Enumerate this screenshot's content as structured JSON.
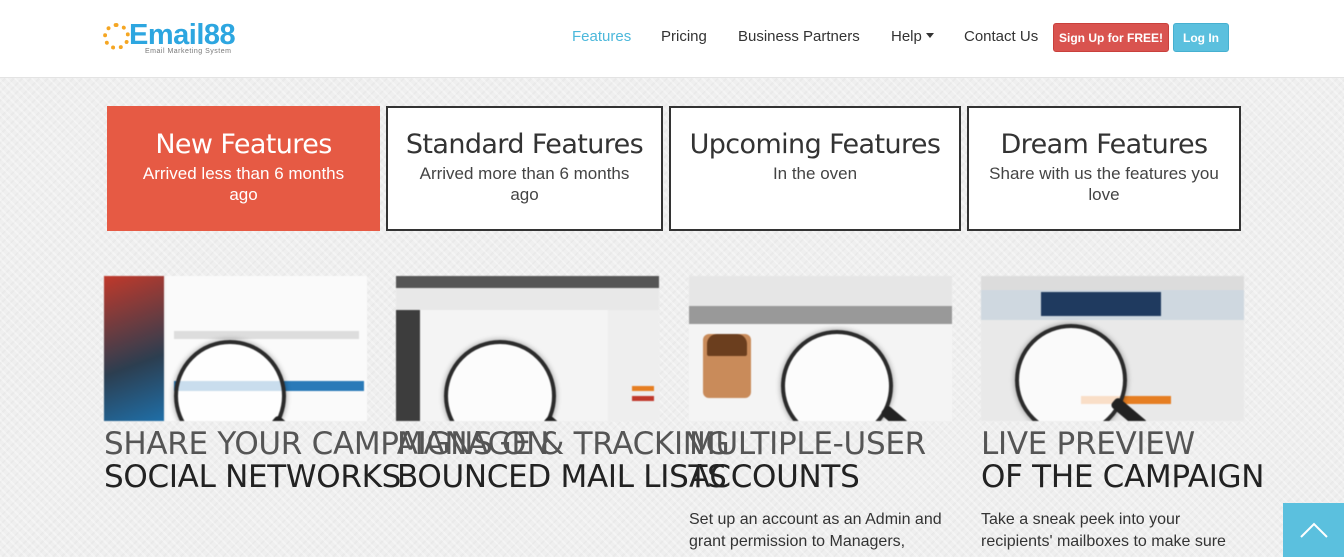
{
  "header": {
    "logo_text": "Email88",
    "logo_tagline": "Email Marketing System",
    "nav": {
      "features": "Features",
      "pricing": "Pricing",
      "business_partners": "Business Partners",
      "help": "Help",
      "contact": "Contact Us"
    },
    "signup_label": "Sign Up for FREE!",
    "login_label": "Log In"
  },
  "tabs": [
    {
      "title": "New Features",
      "subtitle": "Arrived less than 6 months ago"
    },
    {
      "title": "Standard Features",
      "subtitle": "Arrived more than 6 months ago"
    },
    {
      "title": "Upcoming Features",
      "subtitle": "In the oven"
    },
    {
      "title": "Dream Features",
      "subtitle": "Share with us the features you love"
    }
  ],
  "features": [
    {
      "title_light": "Share your campaigns on",
      "title_bold": "social networks",
      "desc": ""
    },
    {
      "title_light": "Manage & tracking",
      "title_bold": "bounced mail lists",
      "desc": ""
    },
    {
      "title_light": "Multiple-user",
      "title_bold": "accounts",
      "desc": "Set up an account as an Admin and grant permission to Managers,"
    },
    {
      "title_light": "Live preview",
      "title_bold": "of the campaign",
      "desc": "Take a sneak peek into your recipients' mailboxes to make sure"
    }
  ],
  "scroll_top_icon": "chevron-up-icon",
  "colors": {
    "accent_red": "#e65a44",
    "brand_blue": "#2da6e0",
    "active_nav": "#4cb8db",
    "signup_red": "#d9534f",
    "login_blue": "#5bc0de"
  }
}
